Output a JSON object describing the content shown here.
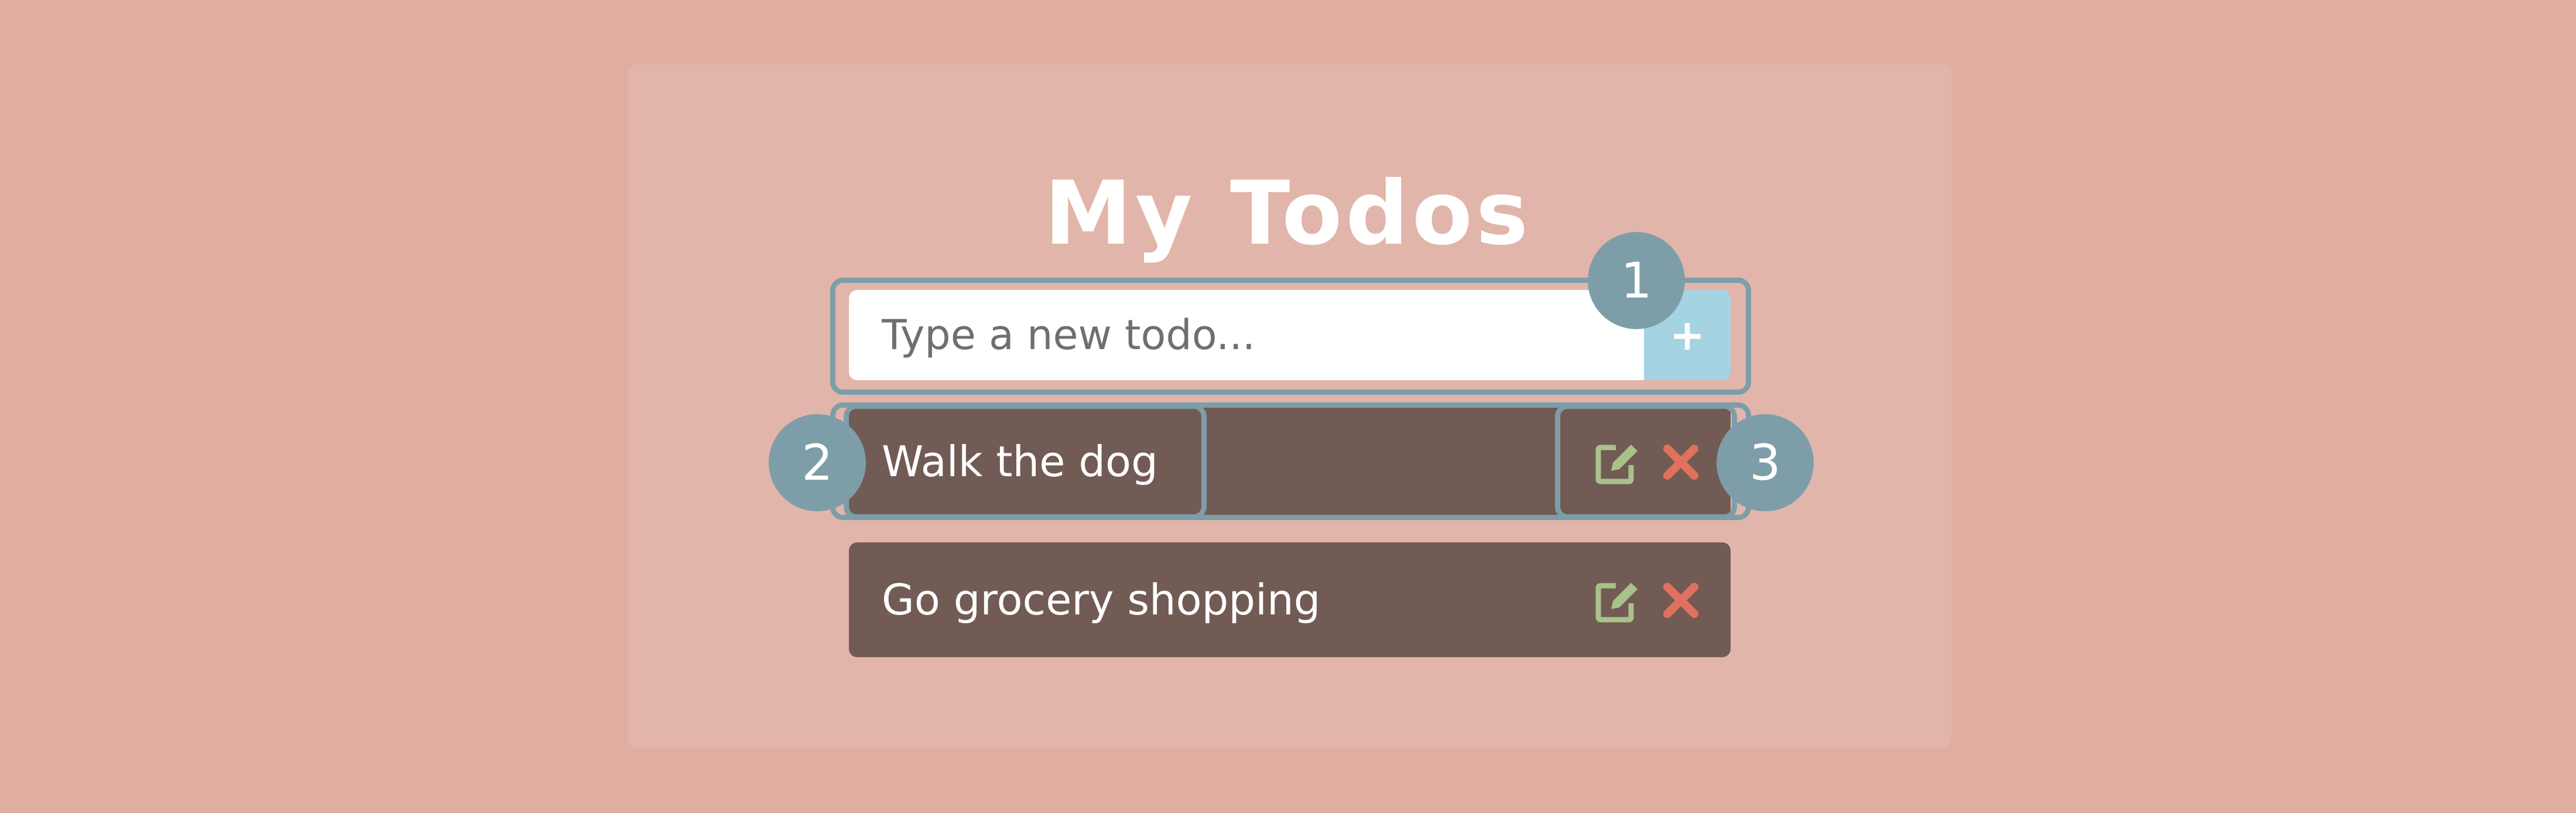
{
  "app": {
    "title": "My Todos"
  },
  "new_todo": {
    "placeholder": "Type a new todo...",
    "value": "",
    "add_label": "+"
  },
  "todos": [
    {
      "text": "Walk the dog",
      "edit_icon": "edit-icon",
      "delete_icon": "close-icon"
    },
    {
      "text": "Go grocery shopping",
      "edit_icon": "edit-icon",
      "delete_icon": "close-icon"
    }
  ],
  "callouts": [
    "1",
    "2",
    "3"
  ],
  "colors": {
    "page_background": "#dfae9f",
    "card_background": "#e2b5aa",
    "todo_background": "#725b54",
    "add_button": "#a5d3e2",
    "callout": "#7d9ea9",
    "edit_icon": "#a8c28a",
    "delete_icon": "#e0715f"
  }
}
